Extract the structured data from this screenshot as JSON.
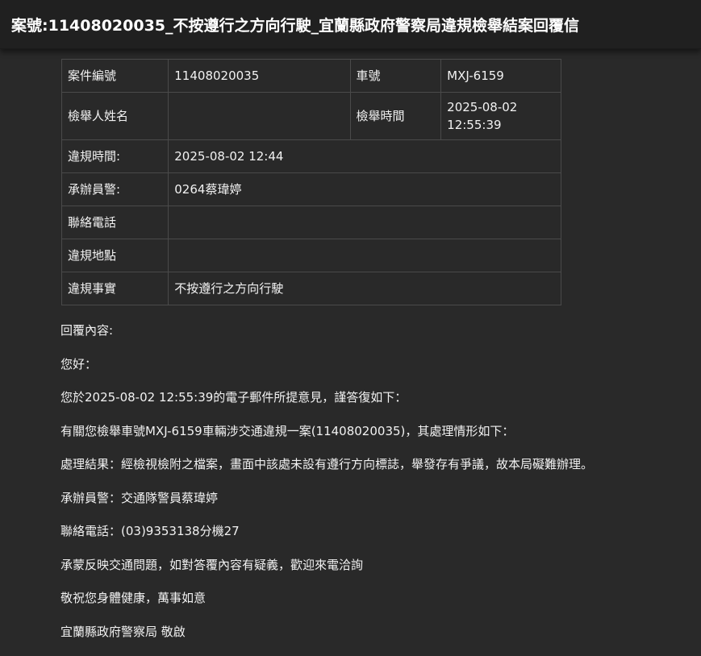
{
  "window": {
    "title": "案號:11408020035_不按遵行之方向行駛_宜蘭縣政府警察局違規檢舉結案回覆信"
  },
  "case_table": {
    "case_no_label": "案件編號",
    "case_no_value": "11408020035",
    "plate_label": "車號",
    "plate_value": "MXJ-6159",
    "reporter_name_label": "檢舉人姓名",
    "reporter_name_value": "",
    "report_time_label": "檢舉時間",
    "report_time_value": "2025-08-02 12:55:39",
    "violation_time_label": "違規時間:",
    "violation_time_value": "2025-08-02 12:44",
    "officer_label": "承辦員警:",
    "officer_value": "0264蔡瑋婷",
    "phone_label": "聯絡電話",
    "phone_value": "",
    "location_label": "違規地點",
    "location_value": "",
    "fact_label": "違規事實",
    "fact_value": "不按遵行之方向行駛"
  },
  "reply": {
    "heading": "回覆內容:",
    "greeting": "您好：",
    "line1": "您於2025-08-02 12:55:39的電子郵件所提意見，謹答復如下：",
    "line2": "有關您檢舉車號MXJ-6159車輛涉交通違規一案(11408020035)，其處理情形如下：",
    "line3": "處理結果：經檢視檢附之檔案，畫面中該處未設有遵行方向標誌，舉發存有爭議，故本局礙難辦理。",
    "line4": "承辦員警：交通隊警員蔡瑋婷",
    "line5": "聯絡電話：(03)9353138分機27",
    "line6": "承蒙反映交通問題，如對答覆內容有疑義，歡迎來電洽詢",
    "line7": "敬祝您身體健康，萬事如意",
    "signature": "宜蘭縣政府警察局 敬啟"
  }
}
